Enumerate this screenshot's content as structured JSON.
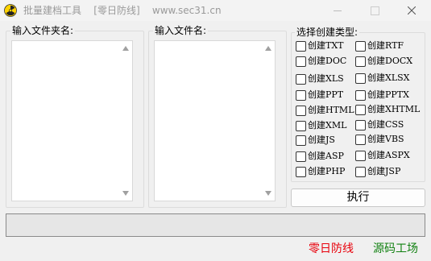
{
  "window": {
    "title": "批量建档工具    [零日防线]    www.sec31.cn",
    "icon": "radiation-icon",
    "controls": [
      "minimize-icon",
      "maximize-icon",
      "close-icon"
    ]
  },
  "folder_panel": {
    "label": "输入文件夹名:"
  },
  "file_panel": {
    "label": "输入文件名:"
  },
  "type_panel": {
    "label": "选择创建类型:",
    "left_options": [
      "创建TXT",
      "创建DOC",
      "创建XLS",
      "创建PPT",
      "创建HTML",
      "创建XML",
      "创建JS",
      "创建ASP",
      "创建PHP"
    ],
    "right_options": [
      "创建RTF",
      "创建DOCX",
      "创建XLSX",
      "创建PPTX",
      "创建XHTML",
      "创建CSS",
      "创建VBS",
      "创建ASPX",
      "创建JSP"
    ]
  },
  "execute_button": "执行",
  "progress": {
    "value": 0
  },
  "footer": {
    "link_left": "零日防线",
    "link_right": "源码工场"
  },
  "colors": {
    "link_left": "#e8000b",
    "link_right": "#108010",
    "progress_fill": "#06b025"
  }
}
